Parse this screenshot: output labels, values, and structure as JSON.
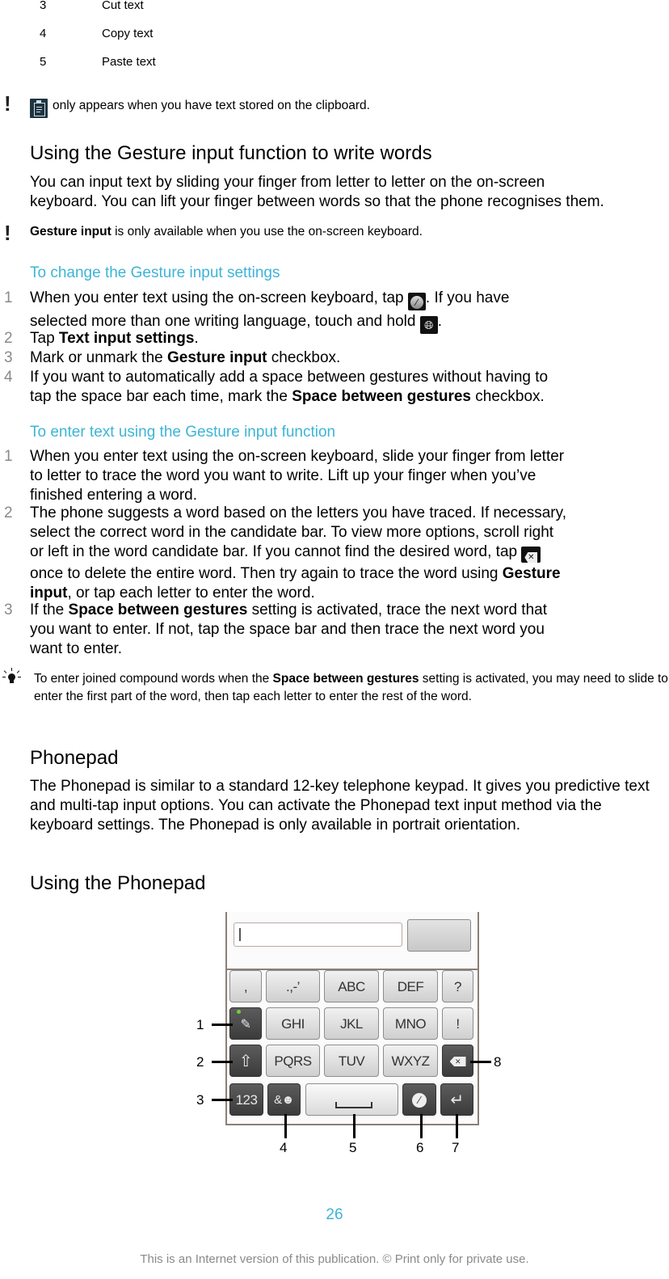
{
  "table_rows": [
    {
      "num": "3",
      "text": "Cut text"
    },
    {
      "num": "4",
      "text": "Copy text"
    },
    {
      "num": "5",
      "text": "Paste text"
    }
  ],
  "clipboard_note": {
    "icon": "clipboard-icon",
    "text": "only appears when you have text stored on the clipboard."
  },
  "gesture_section": {
    "heading": "Using the Gesture input function to write words",
    "intro_line1": "You can input text by sliding your finger from letter to letter on the on-screen",
    "intro_line2": "keyboard. You can lift your finger between words so that the phone recognises them.",
    "note_bold": "Gesture input",
    "note_rest": " is only available when you use the on-screen keyboard."
  },
  "change_settings": {
    "subheading": "To change the Gesture input settings",
    "steps": [
      {
        "num": "1",
        "line1_a": "When you enter text using the on-screen keyboard, tap ",
        "line1_b": ". If you have",
        "line2_a": "selected more than one writing language, touch and hold ",
        "line2_b": "."
      },
      {
        "num": "2",
        "a": "Tap ",
        "bold": "Text input settings",
        "b": "."
      },
      {
        "num": "3",
        "a": "Mark or unmark the ",
        "bold": "Gesture input",
        "b": " checkbox."
      },
      {
        "num": "4",
        "line1": "If you want to automatically add a space between gestures without having to",
        "line2_a": "tap the space bar each time, mark the ",
        "bold": "Space between gestures",
        "line2_b": " checkbox."
      }
    ]
  },
  "enter_text": {
    "subheading": "To enter text using the Gesture input function",
    "steps": [
      {
        "num": "1",
        "lines": [
          "When you enter text using the on-screen keyboard, slide your finger from letter",
          "to letter to trace the word you want to write. Lift up your finger when you’ve",
          "finished entering a word."
        ]
      },
      {
        "num": "2",
        "line1": "The phone suggests a word based on the letters you have traced. If necessary,",
        "line2": "select the correct word in the candidate bar. To view more options, scroll right",
        "line3": "or left in the word candidate bar. If you cannot find the desired word, tap ",
        "line4_a": "once to delete the entire word. Then try again to trace the word using ",
        "line4_bold": "Gesture",
        "line5_bold": "input",
        "line5_b": ", or tap each letter to enter the word."
      },
      {
        "num": "3",
        "line1_a": "If the ",
        "line1_bold": "Space between gestures",
        "line1_b": " setting is activated, trace the next word that",
        "line2": "you want to enter. If not, tap the space bar and then trace the next word you",
        "line3": "want to enter."
      }
    ],
    "tip_a": "To enter joined compound words when the ",
    "tip_bold": "Space between gestures",
    "tip_b": " setting is activated, you may need to slide to enter the first part of the word, then tap each letter to enter the rest of the word."
  },
  "phonepad": {
    "heading": "Phonepad",
    "body": "The Phonepad is similar to a standard 12-key telephone keypad. It gives you predictive text and multi-tap input options. You can activate the Phonepad text input method via the keyboard settings. The Phonepad is only available in portrait orientation.",
    "using_heading": "Using the Phonepad"
  },
  "keypad": {
    "row1": [
      ",",
      ".,-’",
      "ABC",
      "DEF",
      "?"
    ],
    "row2": [
      "GHI",
      "JKL",
      "MNO",
      "!"
    ],
    "row3": [
      "PQRS",
      "TUV",
      "WXYZ"
    ],
    "numbers_key": "123",
    "symbols_key": "&☻",
    "callouts": [
      "1",
      "2",
      "3",
      "4",
      "5",
      "6",
      "7",
      "8"
    ]
  },
  "page_number": "26",
  "footer": "This is an Internet version of this publication. © Print only for private use."
}
